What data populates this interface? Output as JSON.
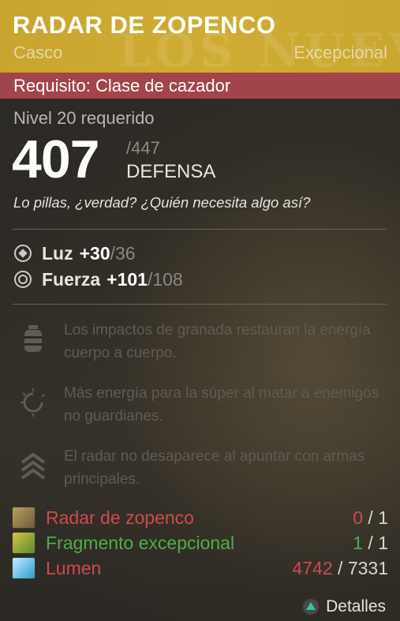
{
  "item": {
    "name": "RADAR DE ZOPENCO",
    "type": "Casco",
    "rarity": "Excepcional",
    "watermark": "LOS NUEVE",
    "requirement": "Requisito: Clase de cazador",
    "level_required": "Nivel 20 requerido",
    "defense_value": "407",
    "defense_max": "/447",
    "defense_label": "DEFENSA",
    "flavor_text": "Lo pillas, ¿verdad? ¿Quién necesita algo así?",
    "header_color": "#c8a530",
    "requirement_color": "#a2454a"
  },
  "stats": [
    {
      "icon": "light-icon",
      "name": "Luz",
      "value": "+30",
      "max": "/36"
    },
    {
      "icon": "strength-icon",
      "name": "Fuerza",
      "value": "+101",
      "max": "/108"
    }
  ],
  "perks": [
    {
      "icon": "grenade-icon",
      "text": "Los impactos de granada restauran la energía cuerpo a cuerpo."
    },
    {
      "icon": "super-energy-icon",
      "text": "Más energía para la súper al matar a enemigos no guardianes."
    },
    {
      "icon": "radar-chevron-icon",
      "text": "El radar no desaparece al apuntar con armas principales."
    }
  ],
  "materials": [
    {
      "icon": "helmet-icon",
      "name": "Radar de zopenco",
      "have": "0",
      "need": "/ 1",
      "color": "#cf4a4f"
    },
    {
      "icon": "exotic-shard-icon",
      "name": "Fragmento excepcional",
      "have": "1",
      "need": "/ 1",
      "color": "#4fae4a"
    },
    {
      "icon": "glimmer-icon",
      "name": "Lumen",
      "have": "4742",
      "need": "/ 7331",
      "color": "#cf4a4f"
    }
  ],
  "footer": {
    "button_icon": "triangle-button-icon",
    "label": "Detalles"
  }
}
